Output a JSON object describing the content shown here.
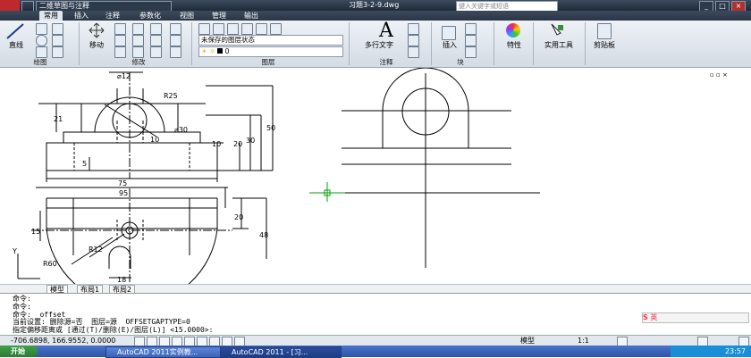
{
  "titlebar": {
    "workspace": "二维草图与注释",
    "document": "习题3-2-9.dwg",
    "search_placeholder": "键入关键字或短语"
  },
  "tabs": [
    "常用",
    "插入",
    "注释",
    "参数化",
    "视图",
    "管理",
    "输出"
  ],
  "ribbon": {
    "line_label": "直线",
    "move_label": "移动",
    "layer_state": "未保存的图层状态",
    "layer_current": "0",
    "mtext_label": "多行文字",
    "insert_label": "插入",
    "properties_label": "特性",
    "utilities_label": "实用工具",
    "clipboard_label": "剪贴板",
    "panels": [
      "绘图",
      "修改",
      "图层",
      "注释",
      "块"
    ]
  },
  "dims": {
    "d12": "⌀12",
    "r25": "R25",
    "d30": "⌀30",
    "v21": "21",
    "v10a": "10",
    "v10b": "10",
    "v20a": "20",
    "v30": "30",
    "v50": "50",
    "v5": "5",
    "h75": "75",
    "h95": "95",
    "v15": "15",
    "v20b": "20",
    "v48": "48",
    "r12": "R12",
    "r60": "R60",
    "h18": "18"
  },
  "modeltabs": [
    "模型",
    "布局1",
    "布局2"
  ],
  "command": {
    "lines": [
      "命令:",
      "命令:",
      "命令: _offset",
      "当前设置: 删除源=否  图层=源  OFFSETGAPTYPE=0",
      "指定偏移距离或 [通过(T)/删除(E)/图层(L)] <15.0000>:"
    ]
  },
  "status": {
    "coords": "-706.6898, 166.9552, 0.0000",
    "model": "模型",
    "scale": "1:1"
  },
  "taskbar": {
    "start": "开始",
    "tasks": [
      "AutoCAD 2011实例教...",
      "AutoCAD 2011 - [习..."
    ],
    "clock": "23:57"
  },
  "colors": {
    "accent": "#2c54a8",
    "titlebar": "#1f2a38",
    "crosshair": "#00a000"
  }
}
